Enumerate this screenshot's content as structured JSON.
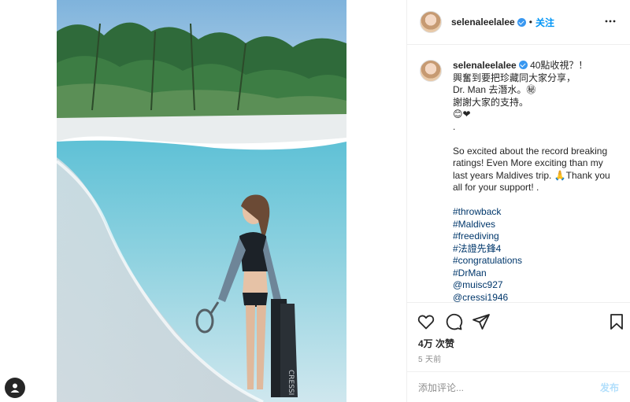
{
  "post": {
    "image_alt": "Woman in swimsuit standing on a beach holding fins and snorkel mask",
    "fin_brand": "CRESSI"
  },
  "header": {
    "username": "selenaleelalee",
    "separator": "•",
    "follow_label": "关注"
  },
  "caption": {
    "username": "selenaleelalee",
    "lines": [
      " 40點收視？！",
      "興奮到要把珍藏同大家分享，",
      "Dr. Man 去潛水。㊙",
      "謝謝大家的支持。",
      "😊❤",
      ".",
      "",
      "So excited about the record breaking",
      "ratings! Even More exciting than my",
      "last years Maldives trip. 🙏Thank you",
      "all for your support! .",
      ""
    ],
    "hashtags": [
      "#throwback",
      "#Maldives",
      "#freediving",
      "#法證先鋒4",
      "#congratulations",
      "#DrMan",
      "@muisc927",
      "@cressi1946"
    ]
  },
  "actions": {
    "icons": [
      "heart-icon",
      "comment-icon",
      "share-icon",
      "bookmark-icon"
    ],
    "likes": "4万 次赞",
    "time_ago": "5 天前"
  },
  "comment_box": {
    "placeholder": "添加评论...",
    "post_label": "发布"
  },
  "colors": {
    "link": "#0095f6",
    "hashtag": "#00376b",
    "muted": "#8e8e8e",
    "border": "#efefef"
  }
}
